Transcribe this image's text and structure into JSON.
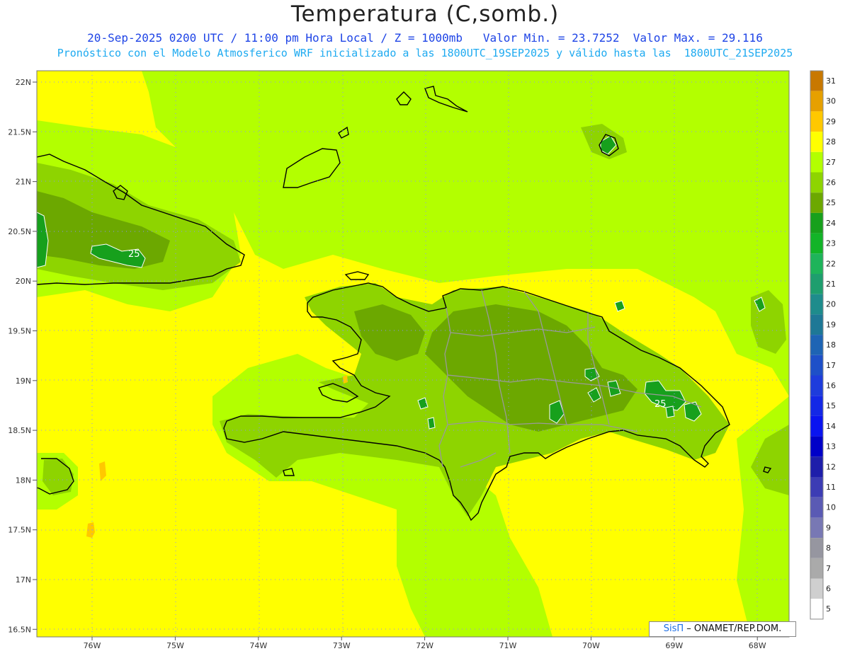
{
  "header": {
    "title": "Temperatura (C,somb.)",
    "subtitle_line1": "20-Sep-2025 0200 UTC / 11:00 pm Hora Local / Z = 1000mb   Valor Min. = 23.7252  Valor Max. = 29.116",
    "subtitle_line2": "Pronóstico con el Modelo Atmosferico WRF inicializado a las 1800UTC_19SEP2025 y válido hasta las  1800UTC_21SEP2025"
  },
  "map": {
    "lat_ticks": [
      "22N",
      "21.5N",
      "21N",
      "20.5N",
      "20N",
      "19.5N",
      "19N",
      "18.5N",
      "18N",
      "17.5N",
      "17N",
      "16.5N"
    ],
    "lon_ticks": [
      "76W",
      "75W",
      "74W",
      "73W",
      "72W",
      "71W",
      "70W",
      "69W",
      "68W"
    ],
    "contour_label": "25",
    "colors": {
      "c28_29": "#ffff00",
      "c27_28": "#b3ff00",
      "c26_27": "#8ed400",
      "c25_26": "#6ca800",
      "c24_25": "#17a01c",
      "coastline": "#000000",
      "border": "#9a9a9a",
      "gridline": "#8c8cff"
    }
  },
  "colorbar": {
    "labels": [
      "31",
      "30",
      "29",
      "28",
      "27",
      "26",
      "25",
      "24",
      "23",
      "22",
      "21",
      "20",
      "19",
      "18",
      "17",
      "16",
      "15",
      "14",
      "13",
      "12",
      "11",
      "10",
      "9",
      "8",
      "7",
      "6",
      "5"
    ],
    "colors": [
      "#c87800",
      "#e6a000",
      "#ffc800",
      "#ffff00",
      "#b3ff00",
      "#8ed400",
      "#6ca800",
      "#17a01c",
      "#12b428",
      "#1eb45a",
      "#1e9e6e",
      "#1e8c8c",
      "#1e7896",
      "#1e64b4",
      "#1e50c8",
      "#1e3cdc",
      "#1428e6",
      "#0a14f0",
      "#0000c8",
      "#1e1eaa",
      "#3c3cb4",
      "#5a5ab4",
      "#7878b4",
      "#9696a0",
      "#aaaaaa",
      "#cfcfcf",
      "#ffffff"
    ]
  },
  "credit": {
    "brand": "SisΠ",
    "text": "– ONAMET/REP.DOM."
  }
}
